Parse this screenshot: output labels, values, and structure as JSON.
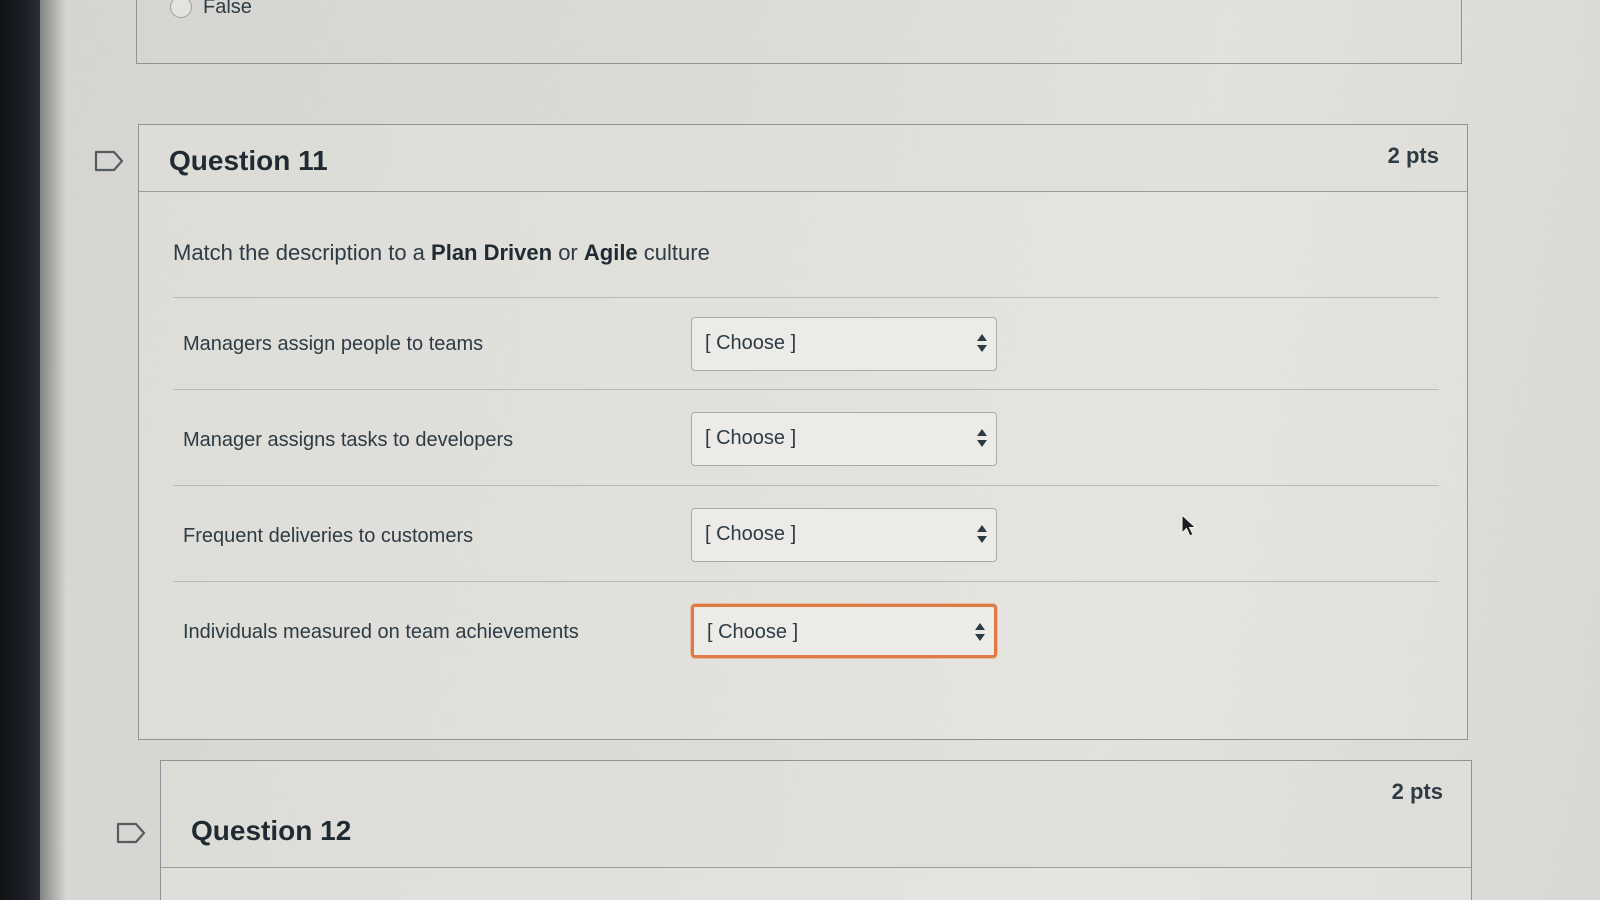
{
  "previous_question": {
    "option_label": "False"
  },
  "question_11": {
    "title": "Question 11",
    "points": "2 pts",
    "prompt_prefix": "Match the description to a ",
    "prompt_bold_1": "Plan Driven",
    "prompt_middle": " or ",
    "prompt_bold_2": "Agile",
    "prompt_suffix": " culture",
    "matches": [
      {
        "label": "Managers assign people to teams",
        "selected": "[ Choose ]"
      },
      {
        "label": "Manager assigns tasks to developers",
        "selected": "[ Choose ]"
      },
      {
        "label": "Frequent deliveries to customers",
        "selected": "[ Choose ]"
      },
      {
        "label": "Individuals measured on team achievements",
        "selected": "[ Choose ]"
      }
    ]
  },
  "question_12": {
    "title": "Question 12",
    "points": "2 pts"
  },
  "colors": {
    "focus_border": "#e07a43",
    "text": "#2d3b45"
  },
  "icons": {
    "flag": "flag-outline-icon",
    "select_arrows": "up-down-arrows-icon",
    "cursor": "mouse-pointer-icon"
  }
}
